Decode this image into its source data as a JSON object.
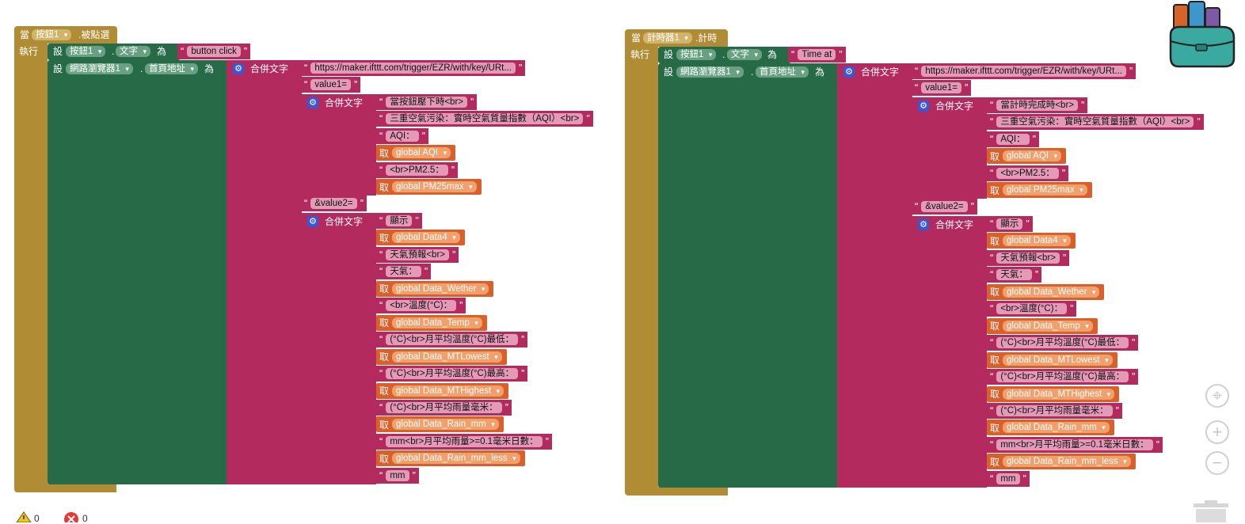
{
  "left": {
    "event": {
      "prefix": "當",
      "component": "按鈕1",
      "suffix": ".被點選"
    },
    "do_label": "執行",
    "set1": {
      "set": "設",
      "component": "按鈕1",
      "dot": ".",
      "property": "文字",
      "to": "為",
      "value": "button click"
    },
    "set2": {
      "set": "設",
      "component": "網路瀏覽器1",
      "dot": ".",
      "property": "首頁地址",
      "to": "為"
    }
  },
  "right": {
    "event": {
      "prefix": "當",
      "component": "計時器1",
      "suffix": ".計時"
    },
    "do_label": "執行",
    "set1": {
      "set": "設",
      "component": "按鈕1",
      "dot": ".",
      "property": "文字",
      "to": "為",
      "value": "Time at"
    },
    "set2": {
      "set": "設",
      "component": "網路瀏覽器1",
      "dot": ".",
      "property": "首頁地址",
      "to": "為"
    }
  },
  "join_label": "合併文字",
  "get_label": "取",
  "url": "https://maker.ifttt.com/trigger/EZR/with/key/URt...",
  "value1": "value1=",
  "value2": "&value2=",
  "left_v1": [
    {
      "kind": "str",
      "text": "當按鈕壓下時<br>"
    },
    {
      "kind": "str",
      "text": "三重空氣污染：實時空氣質量指數（AQI）<br>"
    },
    {
      "kind": "str",
      "text": "AQI："
    },
    {
      "kind": "get",
      "text": "global AQI"
    },
    {
      "kind": "str",
      "text": "<br>PM2.5："
    },
    {
      "kind": "get",
      "text": "global PM25max"
    }
  ],
  "right_v1": [
    {
      "kind": "str",
      "text": "當計時完成時<br>"
    },
    {
      "kind": "str",
      "text": "三重空氣污染：實時空氣質量指數（AQI）<br>"
    },
    {
      "kind": "str",
      "text": "AQI："
    },
    {
      "kind": "get",
      "text": "global AQI"
    },
    {
      "kind": "str",
      "text": "<br>PM2.5："
    },
    {
      "kind": "get",
      "text": "global PM25max"
    }
  ],
  "v2": [
    {
      "kind": "str",
      "text": "顯示"
    },
    {
      "kind": "get",
      "text": "global Data4"
    },
    {
      "kind": "str",
      "text": "天氣預報<br>"
    },
    {
      "kind": "str",
      "text": "天氣："
    },
    {
      "kind": "get",
      "text": "global Data_Wether"
    },
    {
      "kind": "str",
      "text": "<br>溫度(°C)："
    },
    {
      "kind": "get",
      "text": "global Data_Temp"
    },
    {
      "kind": "str",
      "text": "(°C)<br>月平均溫度(°C)最低："
    },
    {
      "kind": "get",
      "text": "global Data_MTLowest"
    },
    {
      "kind": "str",
      "text": "(°C)<br>月平均溫度(°C)最高："
    },
    {
      "kind": "get",
      "text": "global Data_MTHighest"
    },
    {
      "kind": "str",
      "text": "(°C)<br>月平均雨量毫米："
    },
    {
      "kind": "get",
      "text": "global Data_Rain_mm"
    },
    {
      "kind": "str",
      "text": "mm<br>月平均雨量>=0.1毫米日數："
    },
    {
      "kind": "get",
      "text": "global Data_Rain_mm_less"
    },
    {
      "kind": "str",
      "text": "mm"
    }
  ],
  "status": {
    "warnings": "0",
    "errors": "0"
  },
  "colors": {
    "event": "#b08d34",
    "set": "#276a47",
    "join": "#b32b5e",
    "get": "#d95f2b",
    "mutator": "#3a56d0"
  },
  "icons": {
    "backpack": "backpack-icon",
    "warning": "warning-icon",
    "error": "error-icon",
    "recenter": "recenter-icon",
    "zoom_in": "zoom-in-icon",
    "zoom_out": "zoom-out-icon",
    "trash": "trash-icon"
  }
}
